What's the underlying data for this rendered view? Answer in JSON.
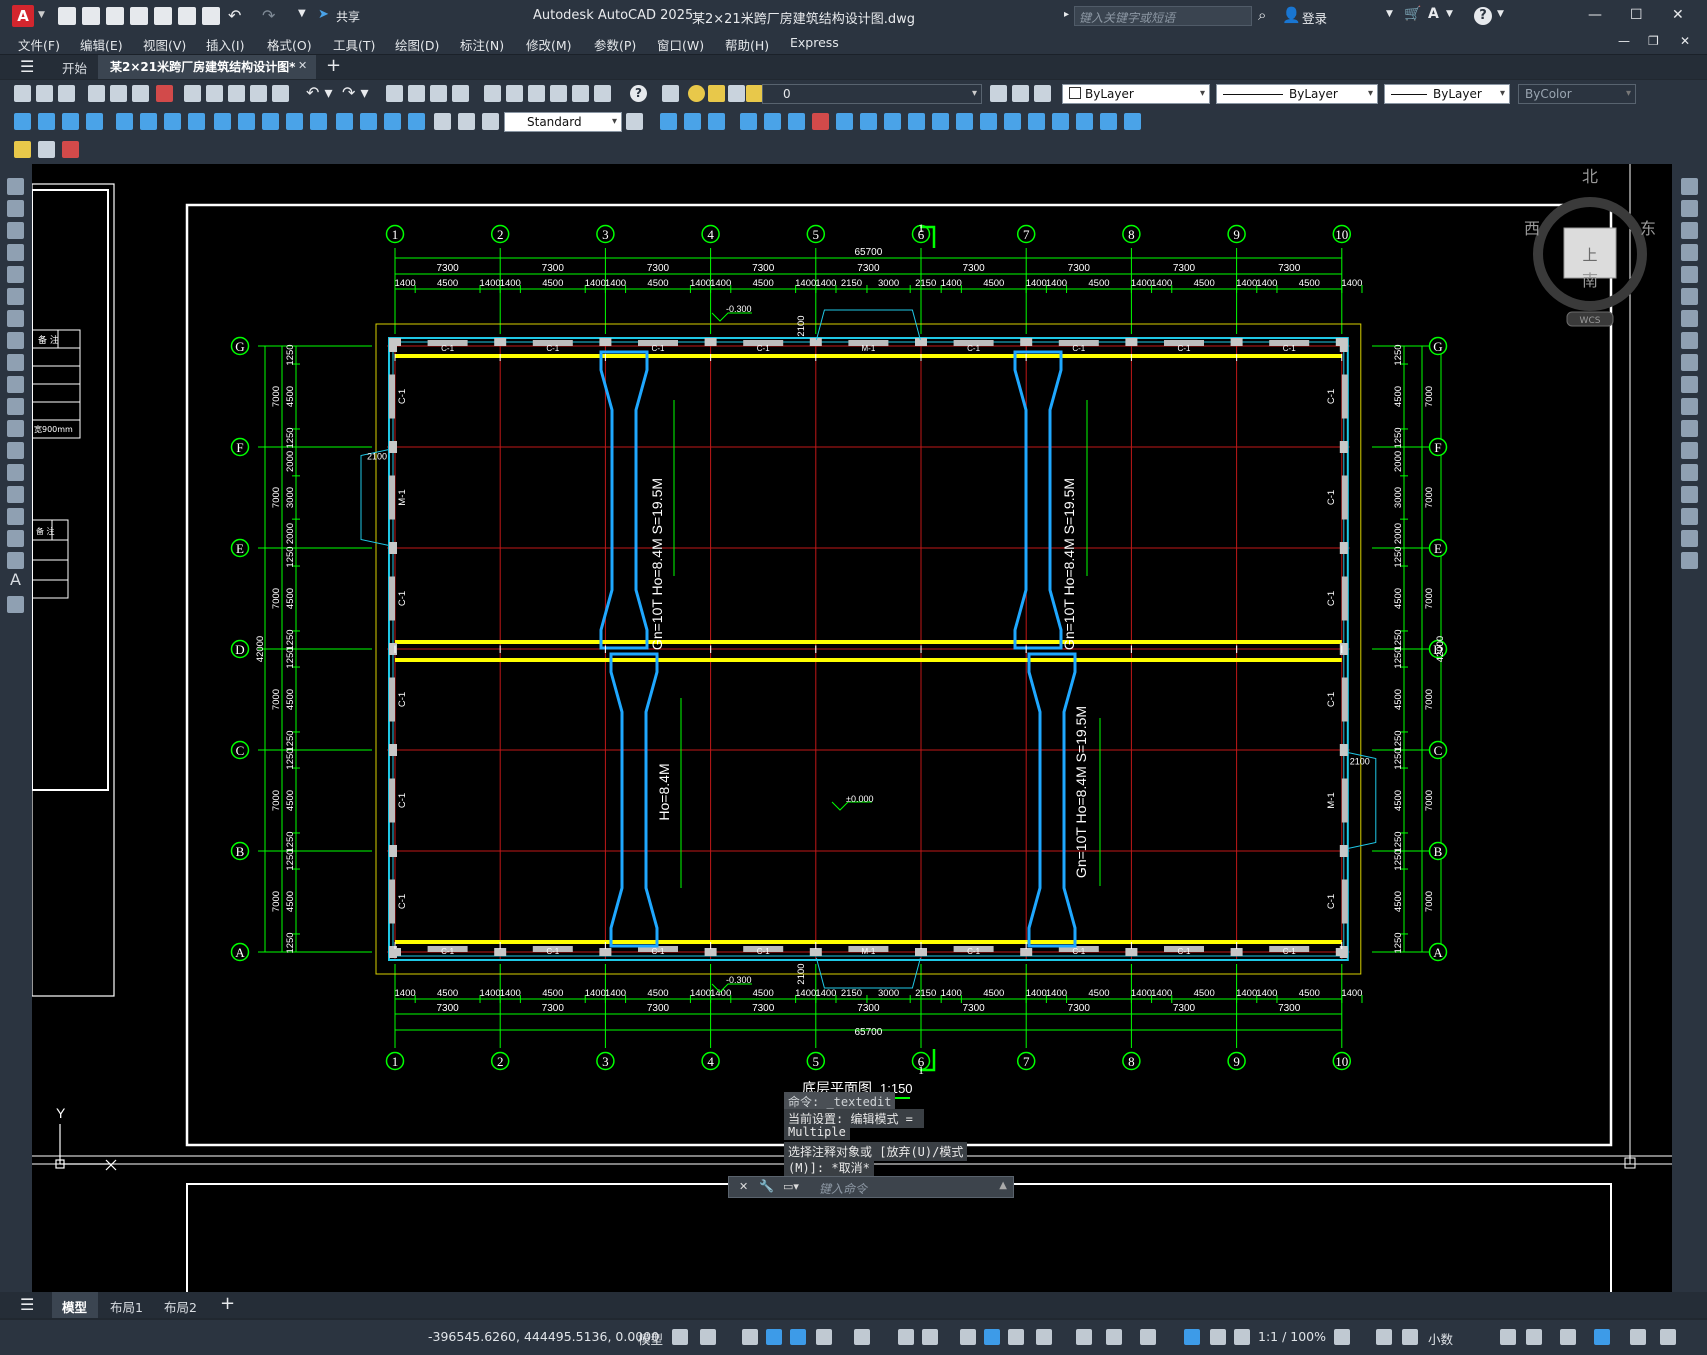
{
  "app": {
    "title": "Autodesk AutoCAD 2025",
    "document": "某2×21米跨厂房建筑结构设计图.dwg",
    "search_placeholder": "键入关键字或短语",
    "login": "登录",
    "share": "共享"
  },
  "menu": [
    "文件(F)",
    "编辑(E)",
    "视图(V)",
    "插入(I)",
    "格式(O)",
    "工具(T)",
    "绘图(D)",
    "标注(N)",
    "修改(M)",
    "参数(P)",
    "窗口(W)",
    "帮助(H)",
    "Express"
  ],
  "tabs": {
    "start": "开始",
    "doc": "某2×21米跨厂房建筑结构设计图*"
  },
  "toolbar": {
    "layer_value": "0",
    "color": "ByLayer",
    "linetype": "ByLayer",
    "lineweight": "ByLayer",
    "plotstyle": "ByColor",
    "textstyle": "Standard"
  },
  "viewcube": {
    "north": "北",
    "south": "南",
    "east": "东",
    "west": "西",
    "top": "上",
    "wcs": "WCS"
  },
  "drawing": {
    "axes_x": [
      "1",
      "2",
      "3",
      "4",
      "5",
      "6",
      "7",
      "8",
      "9",
      "10"
    ],
    "axes_y": [
      "G",
      "F",
      "E",
      "D",
      "C",
      "B",
      "A"
    ],
    "total_width": "65700",
    "total_depth": "42000",
    "bay": "7300",
    "sub_top": [
      "1400",
      "4500",
      "1400",
      "1400",
      "4500",
      "1400",
      "1400",
      "4500",
      "1400",
      "1400",
      "4500",
      "1400",
      "1400",
      "2150",
      "3000",
      "2150",
      "1400",
      "4500",
      "1400",
      "1400",
      "4500",
      "1400",
      "1400",
      "4500",
      "1400",
      "1400",
      "4500",
      "1400"
    ],
    "row_dims": [
      "1250",
      "4500",
      "1250",
      "2000",
      "3000",
      "2000",
      "1250",
      "4500",
      "1250",
      "1250",
      "4500",
      "1250",
      "1250",
      "4500",
      "1250",
      "1250",
      "4500",
      "1250"
    ],
    "row_major": "7000",
    "window_label": "C-1",
    "door_label": "M-1",
    "door_width": "2100",
    "elev_outside": "-0.300",
    "elev_inside": "±0.000",
    "crane_1": "Gn=10T Ho=8.4M S=19.5M",
    "crane_2": "Gn=10T Ho=8.4M S=19.5M",
    "crane_3": "Ho=8.4M",
    "crane_4": "Gn=10T Ho=8.4M S=19.5M",
    "section_mark": "1",
    "plan_title": "底层平面图",
    "plan_scale": "1:150",
    "table_header_1": "备 注",
    "table_cell": "宽900mm",
    "ucs_y": "Y"
  },
  "command": {
    "line1": "命令: _textedit",
    "line2": "当前设置: 编辑模式 = ",
    "line3": "Multiple",
    "line4": "选择注释对象或 [放弃(U)/模式",
    "line5": "(M)]: *取消*",
    "placeholder": "键入命令"
  },
  "layouts": [
    "模型",
    "布局1",
    "布局2"
  ],
  "status": {
    "coords": "-396545.6260, 444495.5136, 0.0000",
    "model": "模型",
    "scale": "1:1 / 100%",
    "units": "小数"
  }
}
